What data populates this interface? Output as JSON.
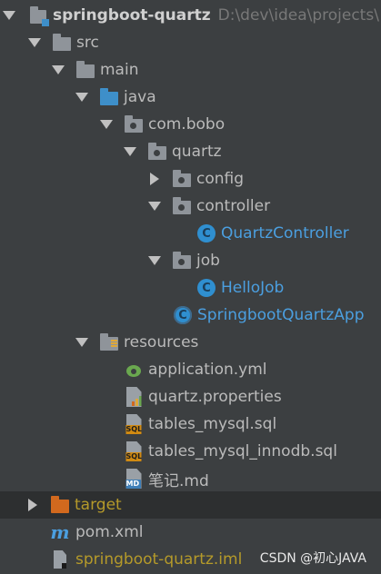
{
  "tree": {
    "root": {
      "label": "springboot-quartz",
      "path": "D:\\dev\\idea\\projects\\"
    },
    "nodes": [
      {
        "label": "src"
      },
      {
        "label": "main"
      },
      {
        "label": "java"
      },
      {
        "label": "com.bobo"
      },
      {
        "label": "quartz"
      },
      {
        "label": "config"
      },
      {
        "label": "controller"
      },
      {
        "label": "QuartzController",
        "icon_text": "C"
      },
      {
        "label": "job"
      },
      {
        "label": "HelloJob",
        "icon_text": "C"
      },
      {
        "label": "SpringbootQuartzApp",
        "icon_text": "C"
      },
      {
        "label": "resources"
      },
      {
        "label": "application.yml"
      },
      {
        "label": "quartz.properties"
      },
      {
        "label": "tables_mysql.sql",
        "badge": "SQL"
      },
      {
        "label": "tables_mysql_innodb.sql",
        "badge": "SQL"
      },
      {
        "label": "笔记.md",
        "badge": "MD"
      },
      {
        "label": "target"
      },
      {
        "label": "pom.xml",
        "icon_text": "m"
      },
      {
        "label": "springboot-quartz.iml"
      }
    ]
  },
  "watermark": "CSDN @初心JAVA",
  "icons": {
    "collapse": "triangle-down-icon",
    "expand": "triangle-right-icon",
    "folder": "folder-icon",
    "class": "java-class-icon",
    "spring": "spring-leaf-icon",
    "sql": "sql-file-icon",
    "markdown": "markdown-file-icon",
    "maven": "maven-icon"
  },
  "colors": {
    "background": "#3c3f41",
    "text": "#bbbbbb",
    "class_text": "#4b9fe0",
    "excluded_text": "#b59a2a",
    "source_folder": "#3e8fc9",
    "excluded_folder": "#d2691e",
    "selected_row": "#2d2f30"
  }
}
